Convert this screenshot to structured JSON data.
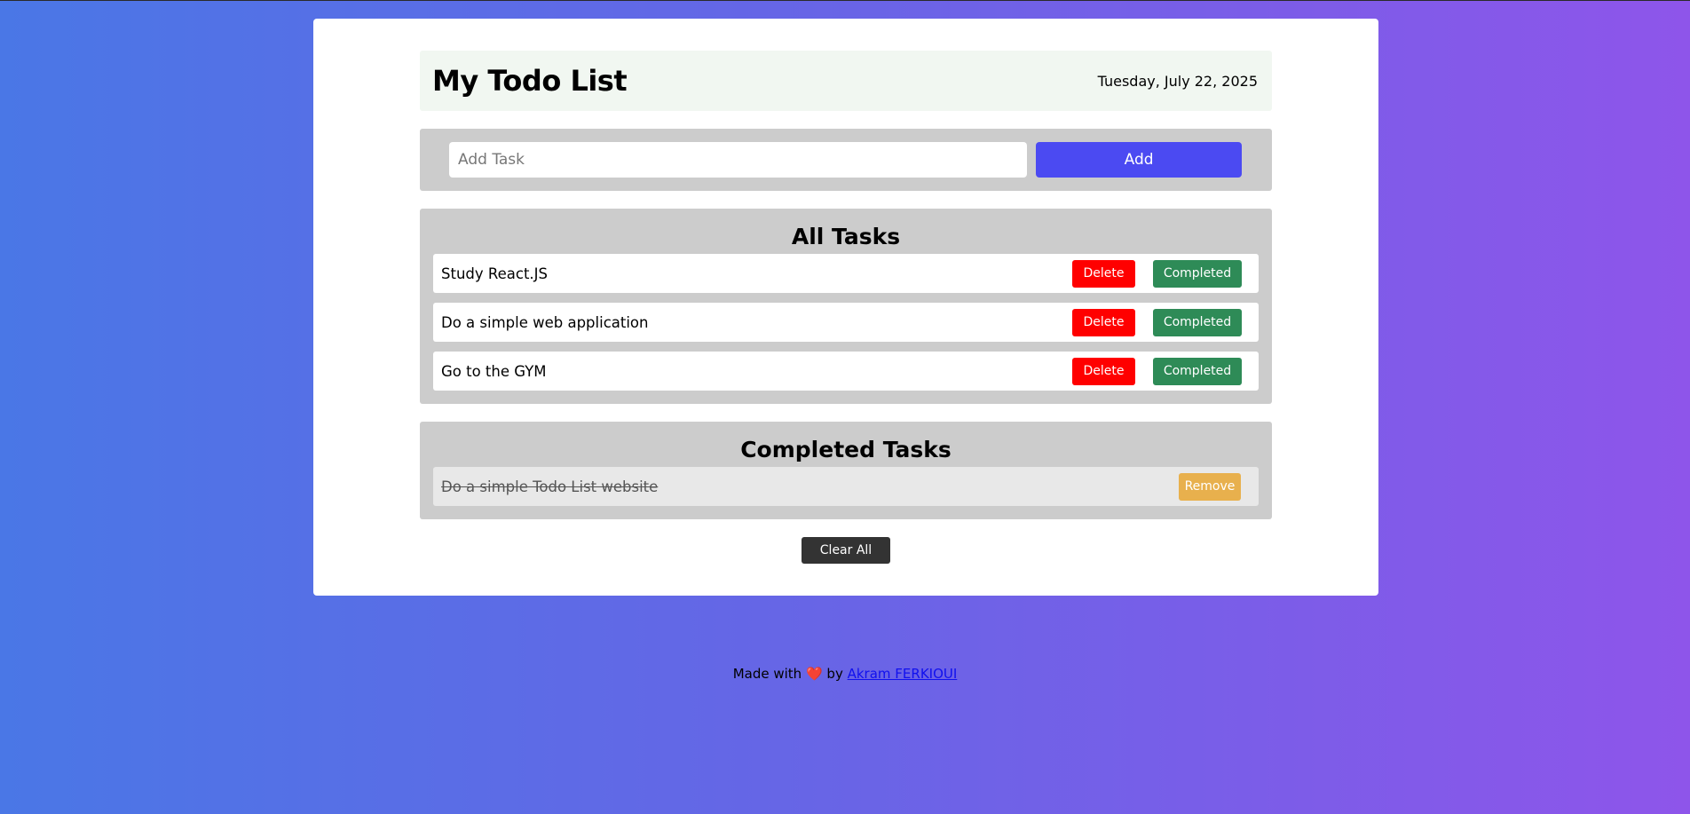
{
  "header": {
    "title": "My Todo List",
    "date": "Tuesday, July 22, 2025"
  },
  "add_task": {
    "placeholder": "Add Task",
    "value": "",
    "button_label": "Add"
  },
  "all_tasks": {
    "title": "All Tasks",
    "delete_label": "Delete",
    "complete_label": "Completed",
    "items": [
      {
        "text": "Study React.JS"
      },
      {
        "text": "Do a simple web application"
      },
      {
        "text": "Go to the GYM"
      }
    ]
  },
  "completed_tasks": {
    "title": "Completed Tasks",
    "remove_label": "Remove",
    "items": [
      {
        "text": "Do a simple Todo List website"
      }
    ]
  },
  "clear_all_label": "Clear All",
  "footer": {
    "prefix": "Made with",
    "heart": "❤️",
    "by": "by",
    "author": "Akram FERKIOUI"
  },
  "colors": {
    "add_button": "#4b4af2",
    "delete_button": "#ff0000",
    "completed_button": "#2e8b57",
    "remove_button": "#e8b04d",
    "clear_button": "#333333"
  }
}
